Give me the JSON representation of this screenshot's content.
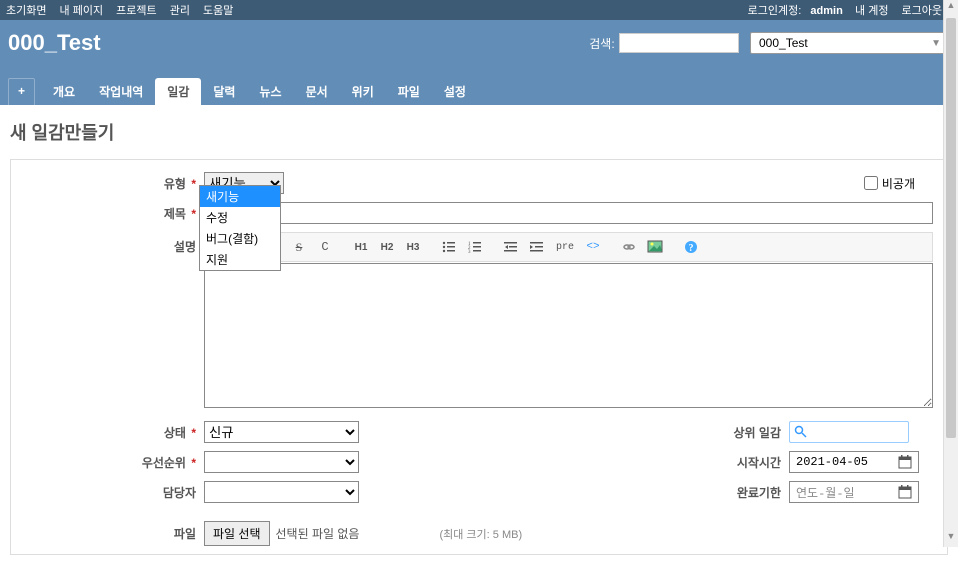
{
  "topMenu": {
    "left": [
      "초기화면",
      "내 페이지",
      "프로젝트",
      "관리",
      "도움말"
    ],
    "rightLabel": "로그인계정:",
    "user": "admin",
    "rightLinks": [
      "내 계정",
      "로그아웃"
    ]
  },
  "header": {
    "title": "000_Test",
    "searchLabel": "검색:",
    "projectSelected": "000_Test"
  },
  "tabs": {
    "plus": "+",
    "items": [
      "개요",
      "작업내역",
      "일감",
      "달력",
      "뉴스",
      "문서",
      "위키",
      "파일",
      "설정"
    ],
    "activeIndex": 2
  },
  "page": {
    "heading": "새 일감만들기"
  },
  "form": {
    "typeLabel": "유형",
    "typeValue": "새기능",
    "typeOptions": [
      "새기능",
      "수정",
      "버그(결함)",
      "지원"
    ],
    "privateLabel": "비공개",
    "subjectLabel": "제목",
    "subjectValue": "",
    "descLabel": "설명",
    "descValue": "",
    "statusLabel": "상태",
    "statusValue": "신규",
    "priorityLabel": "우선순위",
    "priorityValue": "",
    "assigneeLabel": "담당자",
    "assigneeValue": "",
    "parentLabel": "상위 일감",
    "startLabel": "시작시간",
    "startValue": "2021-04-05",
    "dueLabel": "완료기한",
    "duePlaceholder": "연도-월-일",
    "fileLabel": "파일",
    "fileButton": "파일 선택",
    "fileNone": "선택된 파일 없음",
    "fileMax": "(최대 크기: 5 MB)"
  },
  "toolbar": {
    "h1": "H1",
    "h2": "H2",
    "h3": "H3",
    "pre": "pre"
  }
}
